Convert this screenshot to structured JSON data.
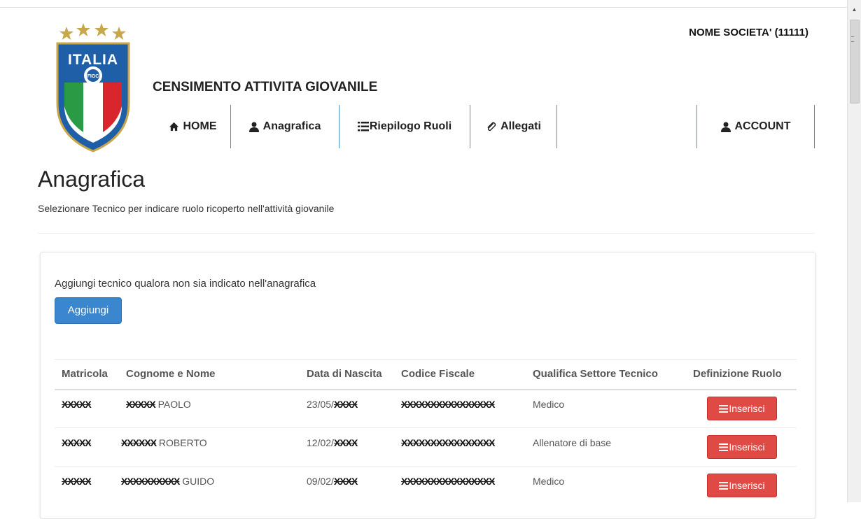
{
  "header": {
    "brand": "NOME SOCIETA' (11111)",
    "app_title": "CENSIMENTO ATTIVITA GIOVANILE",
    "logo_text": "ITALIA"
  },
  "nav": {
    "home": "HOME",
    "anagrafica": "Anagrafica",
    "riepilogo": "Riepilogo Ruoli",
    "allegati": "Allegati",
    "account": "ACCOUNT"
  },
  "page": {
    "title": "Anagrafica",
    "subtitle": "Selezionare Tecnico per indicare ruolo ricoperto nell'attività giovanile"
  },
  "panel": {
    "text": "Aggiungi tecnico qualora non sia indicato nell'anagrafica",
    "add_button": "Aggiungi"
  },
  "table": {
    "headers": [
      "Matricola",
      "Cognome e Nome",
      "Data di Nascita",
      "Codice Fiscale",
      "Qualifica Settore Tecnico",
      "Definizione Ruolo"
    ],
    "rows": [
      {
        "matricola": "XXXXX",
        "cognome": "XXXXX",
        "nome": "PAOLO",
        "data_prefix": "23/05/",
        "data_masked": "XXXX",
        "codice_fiscale": "XXXXXXXXXXXXXXXX",
        "qualifica": "Medico",
        "action": "Inserisci"
      },
      {
        "matricola": "XXXXX",
        "cognome": "XXXXXX",
        "nome": "ROBERTO",
        "data_prefix": "12/02/",
        "data_masked": "XXXX",
        "codice_fiscale": "XXXXXXXXXXXXXXXX",
        "qualifica": "Allenatore di base",
        "action": "Inserisci"
      },
      {
        "matricola": "XXXXX",
        "cognome": "XXXXXXXXXX",
        "nome": "GUIDO",
        "data_prefix": "09/02/",
        "data_masked": "XXXX",
        "codice_fiscale": "XXXXXXXXXXXXXXXX",
        "qualifica": "Medico",
        "action": "Inserisci"
      }
    ]
  },
  "colors": {
    "primary": "#3a87d0",
    "danger": "#e04a45",
    "nav_separator": "#4a90c8"
  },
  "icons": {
    "home": "home-icon",
    "user": "user-icon",
    "list": "list-icon",
    "paperclip": "paperclip-icon",
    "account": "user-icon",
    "insert": "list-icon"
  }
}
